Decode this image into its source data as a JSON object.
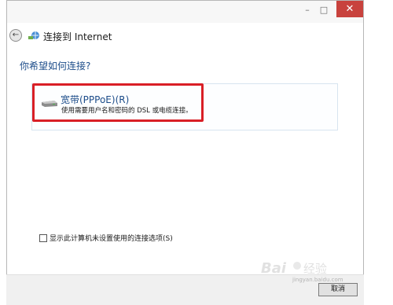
{
  "window": {
    "title": "连接到 Internet",
    "controls": {
      "minimize": "–",
      "maximize": "□",
      "close": "✕"
    }
  },
  "icons": {
    "back": "back-arrow-icon",
    "network": "network-icon",
    "modem": "modem-icon"
  },
  "main": {
    "question": "你希望如何连接?",
    "option": {
      "title": "宽带(PPPoE)(R)",
      "description": "使用需要用户名和密码的 DSL 或电缆连接。"
    },
    "checkbox_label": "显示此计算机未设置使用的连接选项(S)",
    "checkbox_checked": false
  },
  "footer": {
    "cancel_label": "取消"
  },
  "watermark": {
    "text": "Baidu经验",
    "sub": "jingyan.baidu.com"
  },
  "colors": {
    "highlight": "#d91f26",
    "close_button": "#c8423d",
    "heading": "#1d4d8a"
  }
}
